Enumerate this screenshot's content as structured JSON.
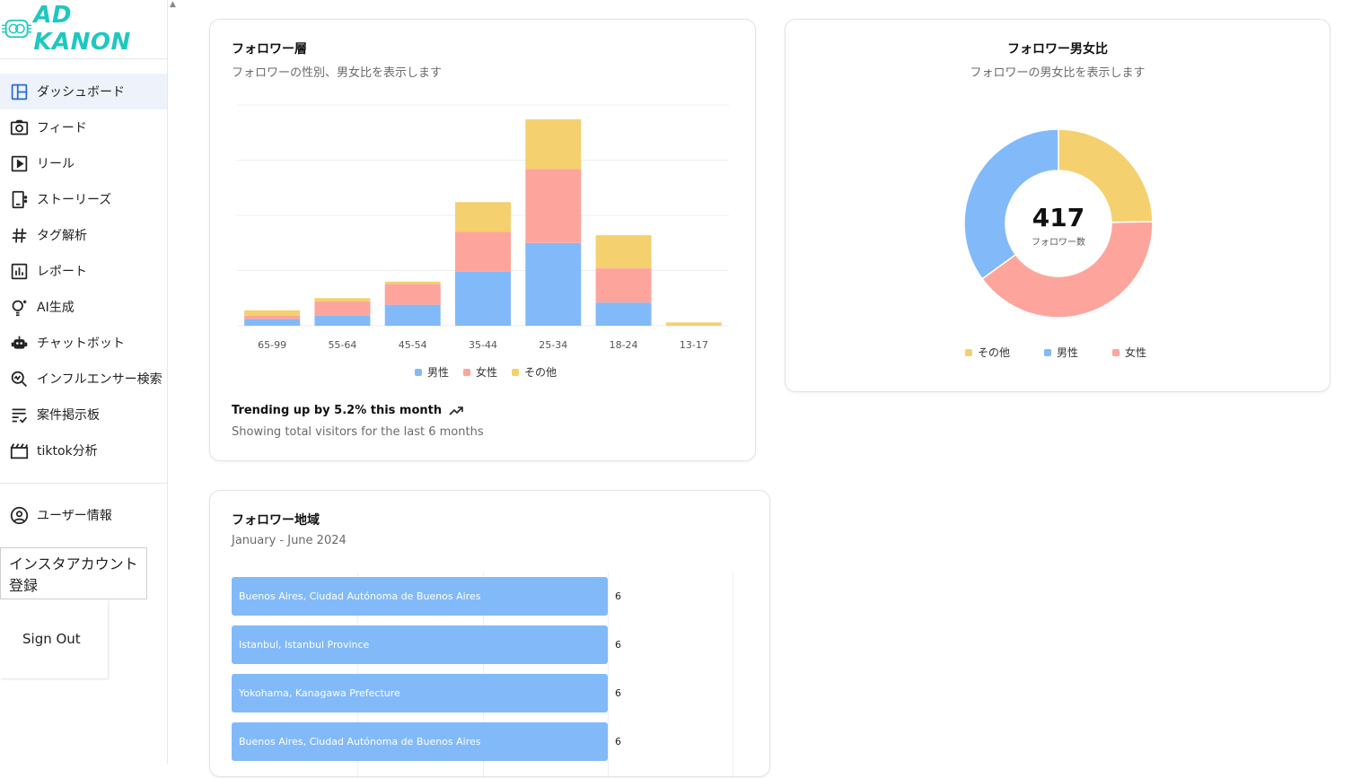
{
  "brand": {
    "name": "AD KANON"
  },
  "sidebar": {
    "items": [
      {
        "label": "ダッシュボード",
        "icon": "dashboard-icon"
      },
      {
        "label": "フィード",
        "icon": "camera-icon"
      },
      {
        "label": "リール",
        "icon": "play-icon"
      },
      {
        "label": "ストーリーズ",
        "icon": "stories-icon"
      },
      {
        "label": "タグ解析",
        "icon": "hashtag-icon"
      },
      {
        "label": "レポート",
        "icon": "report-icon"
      },
      {
        "label": "AI生成",
        "icon": "lightbulb-icon"
      },
      {
        "label": "チャットボット",
        "icon": "robot-icon"
      },
      {
        "label": "インフルエンサー検索",
        "icon": "search-chart-icon"
      },
      {
        "label": "案件掲示板",
        "icon": "list-check-icon"
      },
      {
        "label": "tiktok分析",
        "icon": "clapper-icon"
      }
    ],
    "user_label": "ユーザー情報",
    "insta_register": "インスタアカウント登録",
    "sign_out": "Sign Out"
  },
  "colors": {
    "male": "#82baf9",
    "female": "#fda59d",
    "other": "#f4d06f",
    "accent": "#1ec8c0"
  },
  "age_card": {
    "title": "フォロワー層",
    "subtitle": "フォロワーの性別、男女比を表示します",
    "trend": "Trending up by 5.2% this month",
    "trend_sub": "Showing total visitors for the last 6 months",
    "legend": [
      "男性",
      "女性",
      "その他"
    ]
  },
  "gender_card": {
    "title": "フォロワー男女比",
    "subtitle": "フォロワーの男女比を表示します",
    "total": "417",
    "total_label": "フォロワー数",
    "legend": [
      "その他",
      "男性",
      "女性"
    ]
  },
  "region_card": {
    "title": "フォロワー地域",
    "subtitle": "January - June 2024",
    "rows": [
      {
        "label": "Buenos Aires, Ciudad Autónoma de Buenos Aires",
        "value": "6"
      },
      {
        "label": "Istanbul, Istanbul Province",
        "value": "6"
      },
      {
        "label": "Yokohama, Kanagawa Prefecture",
        "value": "6"
      },
      {
        "label": "Buenos Aires, Ciudad Autónoma de Buenos Aires",
        "value": "6"
      }
    ]
  },
  "chart_data": [
    {
      "type": "bar",
      "stacked": true,
      "categories": [
        "65-99",
        "55-64",
        "45-54",
        "35-44",
        "25-34",
        "18-24",
        "13-17"
      ],
      "series": [
        {
          "name": "男性",
          "values": [
            6,
            9,
            19,
            49,
            75,
            21,
            0
          ]
        },
        {
          "name": "女性",
          "values": [
            3,
            13,
            19,
            36,
            67,
            31,
            0
          ]
        },
        {
          "name": "その他",
          "values": [
            5,
            3,
            2,
            27,
            45,
            30,
            3
          ]
        }
      ],
      "ylim": [
        0,
        200
      ],
      "grid": true,
      "legend": "bottom"
    },
    {
      "type": "pie",
      "donut": true,
      "labels": [
        "その他",
        "女性",
        "男性"
      ],
      "values": [
        103,
        168,
        146
      ],
      "legend": "bottom"
    },
    {
      "type": "bar",
      "orientation": "horizontal",
      "categories": [
        "Buenos Aires, Ciudad Autónoma de Buenos Aires",
        "Istanbul, Istanbul Province",
        "Yokohama, Kanagawa Prefecture",
        "Buenos Aires, Ciudad Autónoma de Buenos Aires"
      ],
      "values": [
        6,
        6,
        6,
        6
      ],
      "xlim": [
        0,
        8.4
      ]
    }
  ]
}
